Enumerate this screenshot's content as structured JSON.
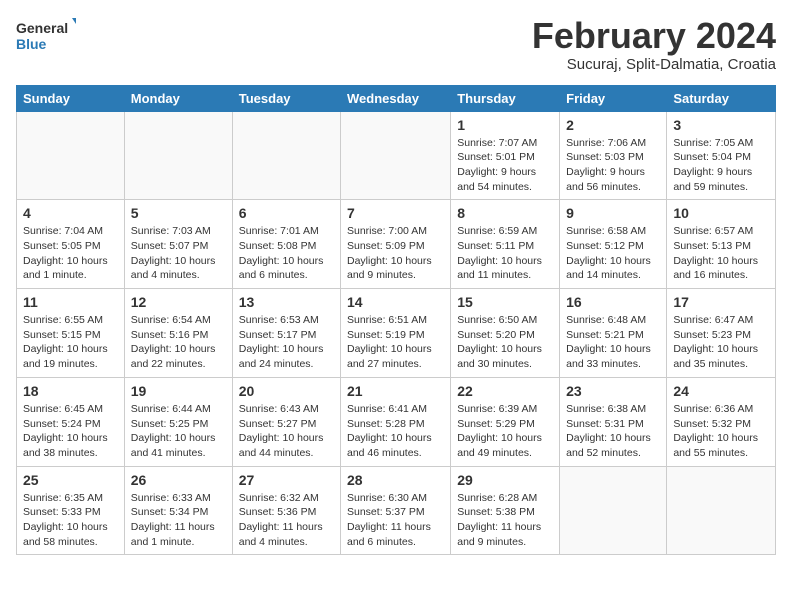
{
  "header": {
    "logo": {
      "general": "General",
      "blue": "Blue"
    },
    "title": "February 2024",
    "subtitle": "Sucuraj, Split-Dalmatia, Croatia"
  },
  "calendar": {
    "days_of_week": [
      "Sunday",
      "Monday",
      "Tuesday",
      "Wednesday",
      "Thursday",
      "Friday",
      "Saturday"
    ],
    "weeks": [
      [
        {
          "day": "",
          "info": ""
        },
        {
          "day": "",
          "info": ""
        },
        {
          "day": "",
          "info": ""
        },
        {
          "day": "",
          "info": ""
        },
        {
          "day": "1",
          "info": "Sunrise: 7:07 AM\nSunset: 5:01 PM\nDaylight: 9 hours and 54 minutes."
        },
        {
          "day": "2",
          "info": "Sunrise: 7:06 AM\nSunset: 5:03 PM\nDaylight: 9 hours and 56 minutes."
        },
        {
          "day": "3",
          "info": "Sunrise: 7:05 AM\nSunset: 5:04 PM\nDaylight: 9 hours and 59 minutes."
        }
      ],
      [
        {
          "day": "4",
          "info": "Sunrise: 7:04 AM\nSunset: 5:05 PM\nDaylight: 10 hours and 1 minute."
        },
        {
          "day": "5",
          "info": "Sunrise: 7:03 AM\nSunset: 5:07 PM\nDaylight: 10 hours and 4 minutes."
        },
        {
          "day": "6",
          "info": "Sunrise: 7:01 AM\nSunset: 5:08 PM\nDaylight: 10 hours and 6 minutes."
        },
        {
          "day": "7",
          "info": "Sunrise: 7:00 AM\nSunset: 5:09 PM\nDaylight: 10 hours and 9 minutes."
        },
        {
          "day": "8",
          "info": "Sunrise: 6:59 AM\nSunset: 5:11 PM\nDaylight: 10 hours and 11 minutes."
        },
        {
          "day": "9",
          "info": "Sunrise: 6:58 AM\nSunset: 5:12 PM\nDaylight: 10 hours and 14 minutes."
        },
        {
          "day": "10",
          "info": "Sunrise: 6:57 AM\nSunset: 5:13 PM\nDaylight: 10 hours and 16 minutes."
        }
      ],
      [
        {
          "day": "11",
          "info": "Sunrise: 6:55 AM\nSunset: 5:15 PM\nDaylight: 10 hours and 19 minutes."
        },
        {
          "day": "12",
          "info": "Sunrise: 6:54 AM\nSunset: 5:16 PM\nDaylight: 10 hours and 22 minutes."
        },
        {
          "day": "13",
          "info": "Sunrise: 6:53 AM\nSunset: 5:17 PM\nDaylight: 10 hours and 24 minutes."
        },
        {
          "day": "14",
          "info": "Sunrise: 6:51 AM\nSunset: 5:19 PM\nDaylight: 10 hours and 27 minutes."
        },
        {
          "day": "15",
          "info": "Sunrise: 6:50 AM\nSunset: 5:20 PM\nDaylight: 10 hours and 30 minutes."
        },
        {
          "day": "16",
          "info": "Sunrise: 6:48 AM\nSunset: 5:21 PM\nDaylight: 10 hours and 33 minutes."
        },
        {
          "day": "17",
          "info": "Sunrise: 6:47 AM\nSunset: 5:23 PM\nDaylight: 10 hours and 35 minutes."
        }
      ],
      [
        {
          "day": "18",
          "info": "Sunrise: 6:45 AM\nSunset: 5:24 PM\nDaylight: 10 hours and 38 minutes."
        },
        {
          "day": "19",
          "info": "Sunrise: 6:44 AM\nSunset: 5:25 PM\nDaylight: 10 hours and 41 minutes."
        },
        {
          "day": "20",
          "info": "Sunrise: 6:43 AM\nSunset: 5:27 PM\nDaylight: 10 hours and 44 minutes."
        },
        {
          "day": "21",
          "info": "Sunrise: 6:41 AM\nSunset: 5:28 PM\nDaylight: 10 hours and 46 minutes."
        },
        {
          "day": "22",
          "info": "Sunrise: 6:39 AM\nSunset: 5:29 PM\nDaylight: 10 hours and 49 minutes."
        },
        {
          "day": "23",
          "info": "Sunrise: 6:38 AM\nSunset: 5:31 PM\nDaylight: 10 hours and 52 minutes."
        },
        {
          "day": "24",
          "info": "Sunrise: 6:36 AM\nSunset: 5:32 PM\nDaylight: 10 hours and 55 minutes."
        }
      ],
      [
        {
          "day": "25",
          "info": "Sunrise: 6:35 AM\nSunset: 5:33 PM\nDaylight: 10 hours and 58 minutes."
        },
        {
          "day": "26",
          "info": "Sunrise: 6:33 AM\nSunset: 5:34 PM\nDaylight: 11 hours and 1 minute."
        },
        {
          "day": "27",
          "info": "Sunrise: 6:32 AM\nSunset: 5:36 PM\nDaylight: 11 hours and 4 minutes."
        },
        {
          "day": "28",
          "info": "Sunrise: 6:30 AM\nSunset: 5:37 PM\nDaylight: 11 hours and 6 minutes."
        },
        {
          "day": "29",
          "info": "Sunrise: 6:28 AM\nSunset: 5:38 PM\nDaylight: 11 hours and 9 minutes."
        },
        {
          "day": "",
          "info": ""
        },
        {
          "day": "",
          "info": ""
        }
      ]
    ]
  }
}
